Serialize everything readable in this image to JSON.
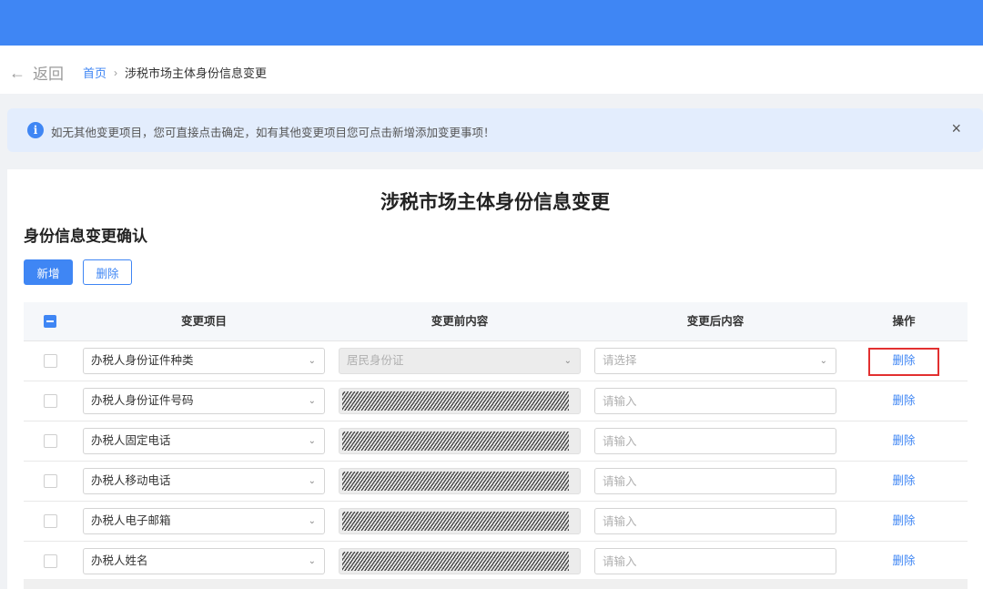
{
  "colors": {
    "brand": "#3f86f4",
    "highlight": "#e23030"
  },
  "nav": {
    "back_label": "返回",
    "back_icon": "arrow-left-icon"
  },
  "breadcrumb": {
    "home": "首页",
    "separator": "›",
    "current": "涉税市场主体身份信息变更"
  },
  "alert": {
    "icon": "info-icon",
    "info_glyph": "i",
    "message": "如无其他变更项目，您可直接点击确定，如有其他变更项目您可点击新增添加变更事项！",
    "close": "×"
  },
  "page": {
    "title": "涉税市场主体身份信息变更",
    "section_title": "身份信息变更确认"
  },
  "toolbar": {
    "add_label": "新增",
    "delete_label": "删除"
  },
  "table": {
    "headers": [
      "变更项目",
      "变更前内容",
      "变更后内容",
      "操作"
    ],
    "rows": [
      {
        "item": "办税人身份证件种类",
        "before": "居民身份证",
        "after_placeholder": "请选择",
        "action": "删除"
      },
      {
        "item": "办税人身份证件号码",
        "after_placeholder": "请输入",
        "action": "删除"
      },
      {
        "item": "办税人固定电话",
        "after_placeholder": "请输入",
        "action": "删除"
      },
      {
        "item": "办税人移动电话",
        "after_placeholder": "请输入",
        "action": "删除"
      },
      {
        "item": "办税人电子邮箱",
        "after_placeholder": "请输入",
        "action": "删除"
      },
      {
        "item": "办税人姓名",
        "after_placeholder": "请输入",
        "action": "删除"
      }
    ]
  }
}
